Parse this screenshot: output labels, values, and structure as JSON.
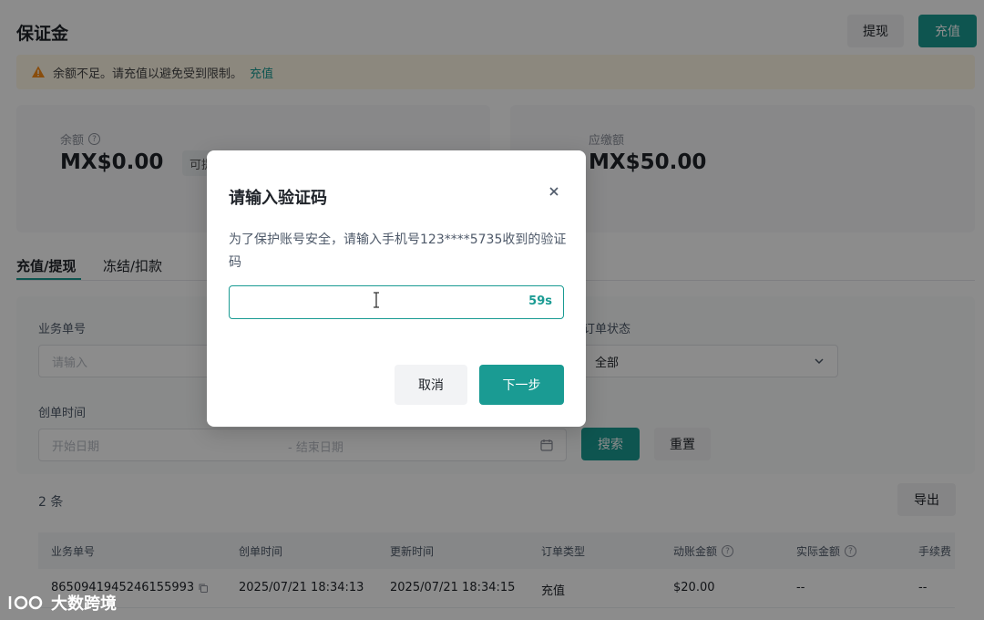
{
  "header": {
    "title": "保证金",
    "withdraw_label": "提现",
    "topup_label": "充值"
  },
  "alert": {
    "text": "余额不足。请充值以避免受到限制。",
    "link": "充值",
    "icon": "warning-icon",
    "color": "#fa8c16"
  },
  "balances": {
    "balance_label": "余额",
    "balance_value": "MX$0.00",
    "available_label": "可提",
    "deposit_label": "应缴额",
    "deposit_value": "MX$50.00"
  },
  "tabs": [
    {
      "label": "充值/提现",
      "active": true
    },
    {
      "label": "冻结/扣款",
      "active": false
    }
  ],
  "filters": {
    "order_no_label": "业务单号",
    "order_no_placeholder": "请输入",
    "status_label": "订单状态",
    "status_value": "全部",
    "created_label": "创单时间",
    "start_placeholder": "开始日期",
    "end_placeholder": "结束日期",
    "date_separator": "-",
    "search_label": "搜索",
    "reset_label": "重置"
  },
  "list": {
    "count": "2 条",
    "export_label": "导出"
  },
  "table": {
    "columns": [
      "业务单号",
      "创单时间",
      "更新时间",
      "订单类型",
      "动账金额",
      "实际金额",
      "手续费"
    ],
    "rows": [
      [
        "8650941945246155993",
        "2025/07/21 18:34:13",
        "2025/07/21 18:34:15",
        "充值",
        "$20.00",
        "--",
        "--"
      ]
    ]
  },
  "modal": {
    "title": "请输入验证码",
    "description": "为了保护账号安全，请输入手机号123****5735收到的验证码",
    "countdown": "59s",
    "cancel_label": "取消",
    "next_label": "下一步"
  },
  "brand": {
    "name": "大数跨境"
  },
  "colors": {
    "accent": "#1a9b93",
    "warning_bg": "#fff7e6"
  }
}
